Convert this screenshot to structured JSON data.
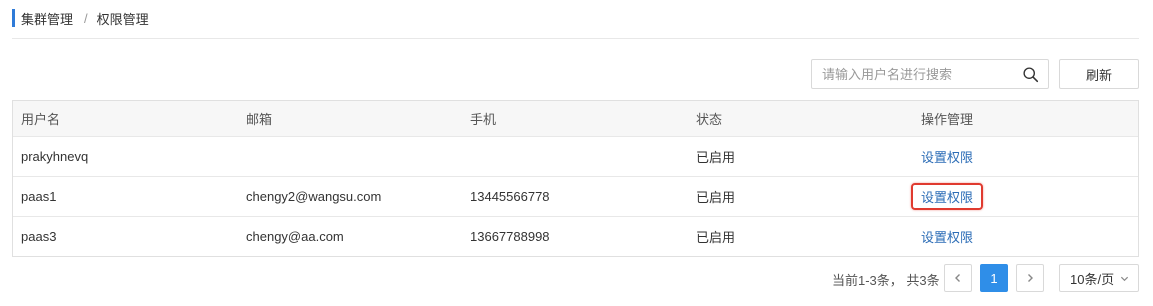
{
  "breadcrumb": {
    "items": [
      "集群管理",
      "权限管理"
    ],
    "separator": "/"
  },
  "search": {
    "placeholder": "请输入用户名进行搜索",
    "value": ""
  },
  "toolbar": {
    "refresh_label": "刷新"
  },
  "table": {
    "columns": [
      "用户名",
      "邮箱",
      "手机",
      "状态",
      "操作管理"
    ],
    "rows": [
      {
        "username": "prakyhnevq",
        "email": "",
        "phone": "",
        "status": "已启用",
        "action": "设置权限",
        "highlighted": false
      },
      {
        "username": "paas1",
        "email": "chengy2@wangsu.com",
        "phone": "13445566778",
        "status": "已启用",
        "action": "设置权限",
        "highlighted": true
      },
      {
        "username": "paas3",
        "email": "chengy@aa.com",
        "phone": "13667788998",
        "status": "已启用",
        "action": "设置权限",
        "highlighted": false
      }
    ]
  },
  "pagination": {
    "total_text": "当前1-3条，  共3条",
    "current_page": "1",
    "page_size_label": "10条/页"
  },
  "colors": {
    "accent": "#2f8ee8",
    "link": "#2b6cb6",
    "highlight_border": "#e03a2f",
    "breadcrumb_bar": "#2f7bd8"
  },
  "icons": [
    "search-icon",
    "chevron-left-icon",
    "chevron-right-icon",
    "chevron-down-icon"
  ]
}
